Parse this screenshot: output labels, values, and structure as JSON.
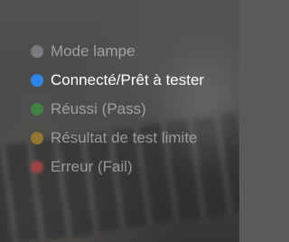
{
  "legend": {
    "items": [
      {
        "label": "Mode lampe",
        "color": "#8e8e95",
        "state": "faded"
      },
      {
        "label": "Connecté/Prêt à tester",
        "color": "#2f86e8",
        "state": "active"
      },
      {
        "label": "Réussi (Pass)",
        "color": "#3e9a45",
        "state": "faded"
      },
      {
        "label": "Résultat de test limite",
        "color": "#b28a2f",
        "state": "faded"
      },
      {
        "label": "Erreur (Fail)",
        "color": "#c24a44",
        "state": "faded"
      }
    ]
  }
}
